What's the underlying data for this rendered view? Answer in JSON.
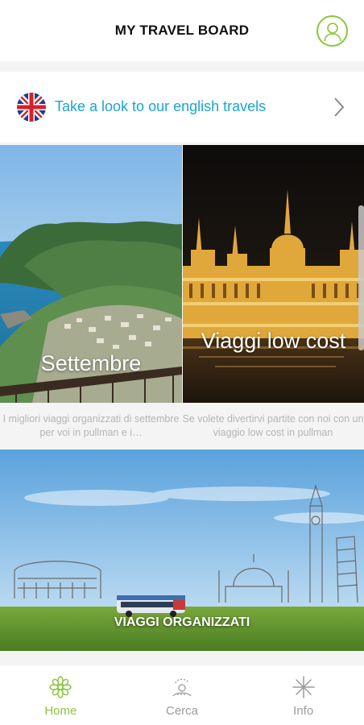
{
  "header": {
    "title": "MY TRAVEL BOARD"
  },
  "english_banner": {
    "text": "Take a look to our english travels"
  },
  "cards": [
    {
      "title": "Settembre",
      "description": "I migliori viaggi organizzati di settembre per voi in pullman e i…"
    },
    {
      "title": "Viaggi low cost",
      "description": "Se volete divertirvi partite con noi con un viaggio low cost in pullman"
    }
  ],
  "banner": {
    "label": "VIAGGI ORGANIZZATI"
  },
  "nav": {
    "items": [
      {
        "label": "Home",
        "icon": "home-flower-icon",
        "active": true
      },
      {
        "label": "Cerca",
        "icon": "search-compass-icon",
        "active": false
      },
      {
        "label": "Info",
        "icon": "info-star-icon",
        "active": false
      }
    ]
  },
  "colors": {
    "accent": "#8cc43f",
    "link": "#1aa3d6"
  }
}
